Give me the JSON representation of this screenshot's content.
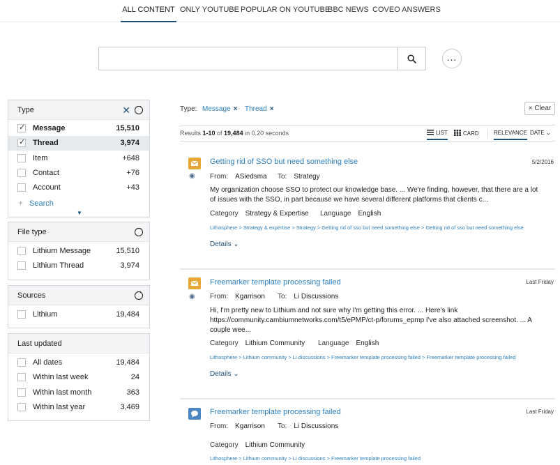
{
  "tabs": [
    "ALL CONTENT",
    "ONLY YOUTUBE",
    "POPULAR ON YOUTUBE",
    "BBC NEWS",
    "COVEO ANSWERS"
  ],
  "search": {
    "value": "",
    "placeholder": ""
  },
  "facets": {
    "type": {
      "title": "Type",
      "values": [
        {
          "label": "Message",
          "count": "15,510",
          "checked": true
        },
        {
          "label": "Thread",
          "count": "3,974",
          "checked": true
        },
        {
          "label": "Item",
          "count": "+648",
          "checked": false
        },
        {
          "label": "Contact",
          "count": "+76",
          "checked": false
        },
        {
          "label": "Account",
          "count": "+43",
          "checked": false
        }
      ],
      "search_label": "Search"
    },
    "file_type": {
      "title": "File type",
      "values": [
        {
          "label": "Lithium Message",
          "count": "15,510"
        },
        {
          "label": "Lithium Thread",
          "count": "3,974"
        }
      ]
    },
    "sources": {
      "title": "Sources",
      "values": [
        {
          "label": "Lithium",
          "count": "19,484"
        }
      ]
    },
    "last_updated": {
      "title": "Last updated",
      "values": [
        {
          "label": "All dates",
          "count": "19,484"
        },
        {
          "label": "Within last week",
          "count": "24"
        },
        {
          "label": "Within last month",
          "count": "363"
        },
        {
          "label": "Within last year",
          "count": "3,469"
        }
      ]
    }
  },
  "breadcrumb": {
    "label": "Type:",
    "values": [
      "Message",
      "Thread"
    ],
    "clear_label": "Clear",
    "clear_icon": "×"
  },
  "summary": {
    "prefix": "Results ",
    "range": "1-10",
    "of": " of ",
    "total": "19,484",
    "suffix": " in 0.20 seconds"
  },
  "layout_options": [
    "LIST",
    "CARD"
  ],
  "sort_options": [
    "RELEVANCE",
    "DATE"
  ],
  "results": [
    {
      "title": "Getting rid of SSO but need something else",
      "date": "5/2/2016",
      "icon": "mail-icon",
      "from_label": "From:",
      "from": "ASiedsma",
      "to_label": "To:",
      "to": "Strategy",
      "excerpt": "My organization choose SSO to protect our knowledge base. ... We're finding, however, that there are a lot of issues with the SSO, in part because we have several different platforms that clients c...",
      "category_label": "Category",
      "category": "Strategy & Expertise",
      "language_label": "Language",
      "language": "English",
      "crumb": "Lithosphere > Strategy & expertise > Strategy > Getting rid of sso but need something else > Getting rid of sso but need something else",
      "details_label": "Details"
    },
    {
      "title": "Freemarker template processing failed",
      "date": "Last Friday",
      "icon": "mail-icon",
      "from_label": "From:",
      "from": "Kgarrison",
      "to_label": "To:",
      "to": "Li Discussions",
      "excerpt": "Hi, I'm pretty new to Lithium and not sure why I'm getting this error. ... Here's link https://community.cambiumnetworks.com/t5/ePMP/ct-p/forums_epmp I've also attached screenshot. ... A couple wee...",
      "category_label": "Category",
      "category": "Lithium Community",
      "language_label": "Language",
      "language": "English",
      "crumb": "Lithosphere > Lithium community > Li discussions > Freemarker template processing failed > Freemarker template processing failed",
      "details_label": "Details"
    },
    {
      "title": "Freemarker template processing failed",
      "date": "Last Friday",
      "icon": "chat-icon",
      "from_label": "From:",
      "from": "Kgarrison",
      "to_label": "To:",
      "to": "Li Discussions",
      "category_label": "Category",
      "category": "Lithium Community",
      "crumb": "Lithosphere > Lithium community > Li discussions > Freemarker template processing failed"
    }
  ],
  "colors": {
    "accent": "#1d4f76",
    "link": "#2b7fbf",
    "mail_icon": "#e8a838",
    "chat_icon": "#4d84c2"
  }
}
